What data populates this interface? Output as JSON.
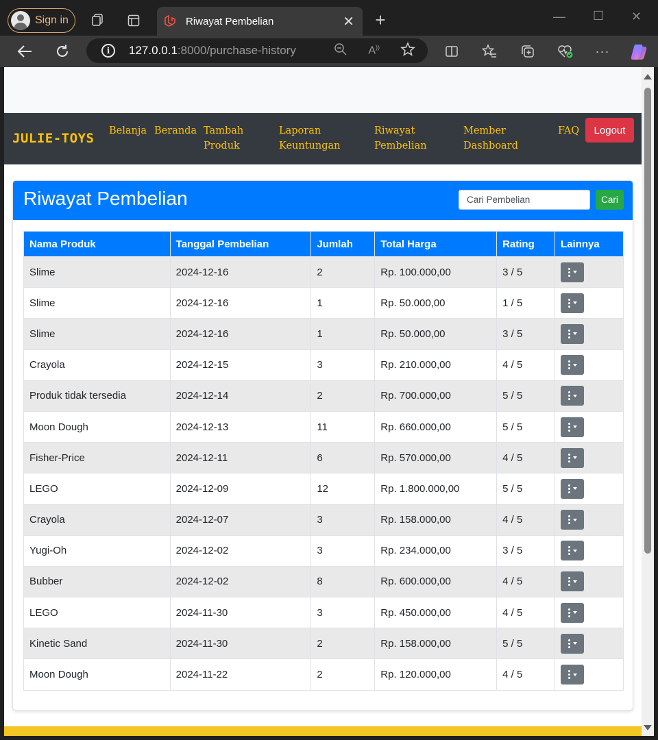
{
  "browser": {
    "sign_in_label": "Sign in",
    "tab_title": "Riwayat Pembelian",
    "url_host": "127.0.0.1",
    "url_rest": ":8000/purchase-history"
  },
  "navbar": {
    "brand": "JULIE-TOYS",
    "links": [
      {
        "line1": "Belanja",
        "line2": ""
      },
      {
        "line1": "Beranda",
        "line2": ""
      },
      {
        "line1": "Tambah",
        "line2": "Produk"
      },
      {
        "line1": "Laporan",
        "line2": "Keuntungan"
      },
      {
        "line1": "Riwayat",
        "line2": "Pembelian"
      },
      {
        "line1": "Member",
        "line2": "Dashboard"
      },
      {
        "line1": "FAQ",
        "line2": ""
      }
    ],
    "logout_label": "Logout"
  },
  "card": {
    "title": "Riwayat Pembelian",
    "search_placeholder": "Cari Pembelian",
    "search_button": "Cari"
  },
  "table": {
    "headers": [
      "Nama Produk",
      "Tanggal Pembelian",
      "Jumlah",
      "Total Harga",
      "Rating",
      "Lainnya"
    ],
    "rows": [
      {
        "product": "Slime",
        "date": "2024-12-16",
        "qty": "2",
        "total": "Rp. 100.000,00",
        "rating": "3 / 5"
      },
      {
        "product": "Slime",
        "date": "2024-12-16",
        "qty": "1",
        "total": "Rp. 50.000,00",
        "rating": "1 / 5"
      },
      {
        "product": "Slime",
        "date": "2024-12-16",
        "qty": "1",
        "total": "Rp. 50.000,00",
        "rating": "3 / 5"
      },
      {
        "product": "Crayola",
        "date": "2024-12-15",
        "qty": "3",
        "total": "Rp. 210.000,00",
        "rating": "4 / 5"
      },
      {
        "product": "Produk tidak tersedia",
        "date": "2024-12-14",
        "qty": "2",
        "total": "Rp. 700.000,00",
        "rating": "5 / 5"
      },
      {
        "product": "Moon Dough",
        "date": "2024-12-13",
        "qty": "11",
        "total": "Rp. 660.000,00",
        "rating": "5 / 5"
      },
      {
        "product": "Fisher-Price",
        "date": "2024-12-11",
        "qty": "6",
        "total": "Rp. 570.000,00",
        "rating": "4 / 5"
      },
      {
        "product": "LEGO",
        "date": "2024-12-09",
        "qty": "12",
        "total": "Rp. 1.800.000,00",
        "rating": "5 / 5"
      },
      {
        "product": "Crayola",
        "date": "2024-12-07",
        "qty": "3",
        "total": "Rp. 158.000,00",
        "rating": "4 / 5"
      },
      {
        "product": "Yugi-Oh",
        "date": "2024-12-02",
        "qty": "3",
        "total": "Rp. 234.000,00",
        "rating": "3 / 5"
      },
      {
        "product": "Bubber",
        "date": "2024-12-02",
        "qty": "8",
        "total": "Rp. 600.000,00",
        "rating": "4 / 5"
      },
      {
        "product": "LEGO",
        "date": "2024-11-30",
        "qty": "3",
        "total": "Rp. 450.000,00",
        "rating": "4 / 5"
      },
      {
        "product": "Kinetic Sand",
        "date": "2024-11-30",
        "qty": "2",
        "total": "Rp. 158.000,00",
        "rating": "5 / 5"
      },
      {
        "product": "Moon Dough",
        "date": "2024-11-22",
        "qty": "2",
        "total": "Rp. 120.000,00",
        "rating": "4 / 5"
      }
    ]
  },
  "colors": {
    "navbar_bg": "#343a40",
    "brand_accent": "#ffc107",
    "primary": "#007bff",
    "success": "#28a745",
    "danger": "#dc3545",
    "secondary": "#6c757d"
  }
}
